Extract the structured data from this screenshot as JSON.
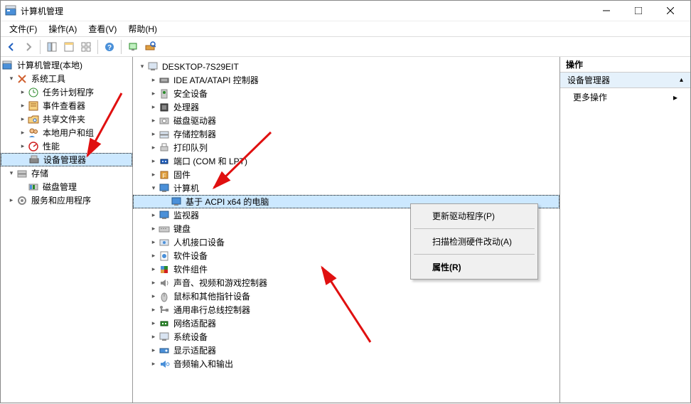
{
  "window": {
    "title": "计算机管理"
  },
  "menubar": [
    "文件(F)",
    "操作(A)",
    "查看(V)",
    "帮助(H)"
  ],
  "lefttree": {
    "root": "计算机管理(本地)",
    "sys": {
      "label": "系统工具",
      "items": [
        "任务计划程序",
        "事件查看器",
        "共享文件夹",
        "本地用户和组",
        "性能"
      ],
      "devmgr": "设备管理器"
    },
    "storage": {
      "label": "存储",
      "items": [
        "磁盘管理"
      ]
    },
    "services": {
      "label": "服务和应用程序"
    }
  },
  "midtree": {
    "root": "DESKTOP-7S29EIT",
    "items_before_computer": [
      "IDE ATA/ATAPI 控制器",
      "安全设备",
      "处理器",
      "磁盘驱动器",
      "存储控制器",
      "打印队列",
      "端口 (COM 和 LPT)",
      "固件"
    ],
    "computer": {
      "label": "计算机",
      "child": "基于 ACPI x64 的电脑"
    },
    "items_after_computer": [
      "监视器",
      "键盘",
      "人机接口设备",
      "软件设备",
      "软件组件",
      "声音、视频和游戏控制器",
      "鼠标和其他指针设备",
      "通用串行总线控制器",
      "网络适配器",
      "系统设备",
      "显示适配器",
      "音频输入和输出"
    ]
  },
  "contextmenu": {
    "update": "更新驱动程序(P)",
    "scan": "扫描检测硬件改动(A)",
    "props": "属性(R)"
  },
  "rightpane": {
    "header": "操作",
    "section": "设备管理器",
    "action": "更多操作"
  }
}
